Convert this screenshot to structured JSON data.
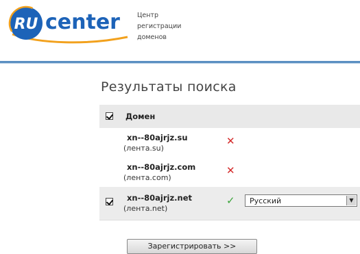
{
  "brand": {
    "logo_prefix": "RU",
    "logo_word": "center",
    "tagline_lines": [
      "Центр",
      "регистрации",
      "доменов"
    ],
    "colors": {
      "brand_blue": "#1d63b8",
      "brand_orange": "#f2a11d",
      "rule_blue": "#5a8fc2"
    }
  },
  "page": {
    "title": "Результаты поиска"
  },
  "results": {
    "column_header": "Домен",
    "header_checked": true,
    "rows": [
      {
        "domain": "xn--80ajrjz.su",
        "alias": "(лента.su)",
        "available": false,
        "status_icon": "cross-icon",
        "status_glyph": "✕"
      },
      {
        "domain": "xn--80ajrjz.com",
        "alias": "(лента.com)",
        "available": false,
        "status_icon": "cross-icon",
        "status_glyph": "✕"
      },
      {
        "domain": "xn--80ajrjz.net",
        "alias": "(лента.net)",
        "available": true,
        "checked": true,
        "status_icon": "checkmark-icon",
        "status_glyph": "✓",
        "language": "Русский"
      }
    ]
  },
  "actions": {
    "register_label": "Зарегистрировать >>"
  }
}
